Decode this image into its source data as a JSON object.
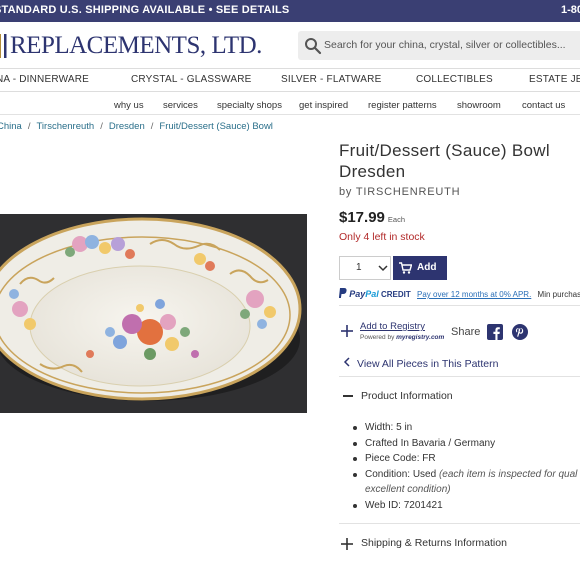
{
  "top_banner": {
    "promo": "STANDARD U.S. SHIPPING AVAILABLE • SEE DETAILS",
    "phone": "1-80"
  },
  "header": {
    "logo_text": "REPLACEMENTS, LTD.",
    "search_placeholder": "Search for your china, crystal, silver or collectibles..."
  },
  "category_nav": [
    "NA - DINNERWARE",
    "CRYSTAL - GLASSWARE",
    "SILVER - FLATWARE",
    "COLLECTIBLES",
    "ESTATE JEW"
  ],
  "utility_nav": [
    "why us",
    "services",
    "specialty shops",
    "get inspired",
    "register patterns",
    "showroom",
    "contact us"
  ],
  "breadcrumb": [
    "China",
    "Tirschenreuth",
    "Dresden",
    "Fruit/Dessert (Sauce) Bowl"
  ],
  "product": {
    "title_line1": "Fruit/Dessert (Sauce) Bowl",
    "title_line2": "Dresden",
    "by": "by TIRSCHENREUTH",
    "price": "$17.99",
    "price_unit": "Each",
    "stock": "Only 4 left in stock",
    "quantity": "1",
    "add_label": "Add"
  },
  "paypal": {
    "brand_a": "Pay",
    "brand_b": "Pal",
    "credit": "CREDIT",
    "link": "Pay over 12 months at 0% APR.",
    "tail": "Min purchase re"
  },
  "registry": {
    "link": "Add to Registry",
    "powered": "Powered by",
    "powered_brand": "myregistry.com"
  },
  "share_label": "Share",
  "view_all": "View All Pieces in This Pattern",
  "product_info": {
    "heading": "Product Information",
    "items": [
      {
        "label": "Width:",
        "value": "5 in"
      },
      {
        "label": "Crafted In",
        "value": "Bavaria / Germany"
      },
      {
        "label": "Piece Code:",
        "value": "FR"
      },
      {
        "label": "Condition:",
        "value": "Used",
        "note": "(each item is inspected for qual",
        "note_cont": "excellent condition)"
      },
      {
        "label": "Web ID:",
        "value": "7201421"
      }
    ]
  },
  "shipping_heading": "Shipping & Returns Information",
  "colors": {
    "brand_navy": "#2d3470",
    "banner": "#3a3f73",
    "stock_red": "#b22a2a",
    "link_teal": "#2a6f8a"
  }
}
